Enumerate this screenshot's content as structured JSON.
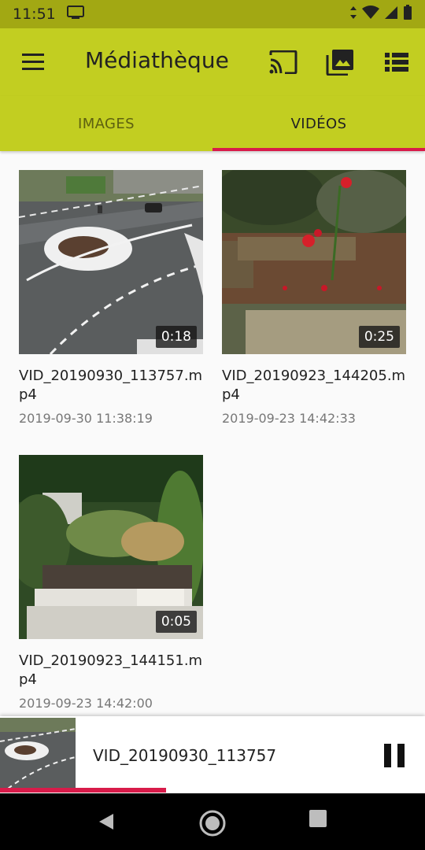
{
  "status_bar": {
    "time": "11:51"
  },
  "app_bar": {
    "title": "Médiathèque",
    "icons": [
      "menu-icon",
      "cast-icon",
      "photo-library-icon",
      "view-list-icon"
    ]
  },
  "tabs": [
    {
      "label": "IMAGES",
      "active": false
    },
    {
      "label": "VIDÉOS",
      "active": true
    }
  ],
  "videos": [
    {
      "filename": "VID_20190930_113757.mp4",
      "date": "2019-09-30  11:38:19",
      "duration": "0:18"
    },
    {
      "filename": "VID_20190923_144205.mp4",
      "date": "2019-09-23  14:42:33",
      "duration": "0:25"
    },
    {
      "filename": "VID_20190923_144151.mp4",
      "date": "2019-09-23  14:42:00",
      "duration": "0:05"
    }
  ],
  "player": {
    "title": "VID_20190930_113757",
    "progress": 0.39,
    "state_icon": "pause-icon"
  },
  "colors": {
    "app_bar": "#c2ce21",
    "status_bar": "#a2a813",
    "accent": "#d81b4a"
  }
}
